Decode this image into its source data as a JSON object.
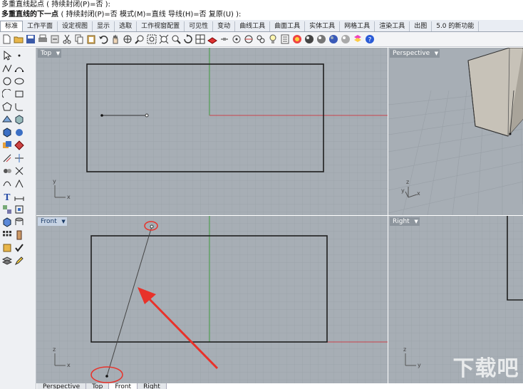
{
  "command": {
    "line1": "多重直线起点 ( 持续封闭(P)=否 ):",
    "line2_prompt": "多重直线的下一点",
    "line2_options": "( 持续封闭(P)=否  模式(M)=直线  导线(H)=否  复原(U) ):"
  },
  "tabs": [
    {
      "label": "标准",
      "active": true
    },
    {
      "label": "工作平面"
    },
    {
      "label": "设定视图"
    },
    {
      "label": "显示"
    },
    {
      "label": "选取"
    },
    {
      "label": "工作视窗配置"
    },
    {
      "label": "可见性"
    },
    {
      "label": "变动"
    },
    {
      "label": "曲线工具"
    },
    {
      "label": "曲面工具"
    },
    {
      "label": "实体工具"
    },
    {
      "label": "网格工具"
    },
    {
      "label": "渲染工具"
    },
    {
      "label": "出图"
    },
    {
      "label": "5.0 的新功能"
    }
  ],
  "toolbar_icons": [
    "new-icon",
    "open-icon",
    "save-icon",
    "print-icon",
    "import-icon",
    "cut-icon",
    "copy-icon",
    "paste-icon",
    "undo-icon",
    "pan-icon",
    "rotate-view-icon",
    "zoom-icon",
    "zoom-window-icon",
    "zoom-extents-icon",
    "zoom-selected-icon",
    "rotate-icon",
    "four-viewports-icon",
    "cplane-icon",
    "select-icon",
    "point-icon",
    "circle-icon",
    "analyze-icon",
    "light-icon",
    "properties-icon",
    "shaded-icon",
    "rendered-icon",
    "render-icon",
    "material-icon",
    "sphere-icon",
    "layer-icon",
    "help-icon"
  ],
  "viewports": {
    "top": "Top",
    "perspective": "Perspective",
    "front": "Front",
    "right": "Right"
  },
  "axes": {
    "x": "x",
    "y": "y",
    "z": "z"
  },
  "bottom_tabs": [
    {
      "label": "Perspective"
    },
    {
      "label": "Top"
    },
    {
      "label": "Front",
      "active": true
    },
    {
      "label": "Right"
    }
  ],
  "watermark": "下载吧",
  "colors": {
    "viewport_bg": "#a7aeb5",
    "grid_line": "#9aa1a8",
    "x_axis": "#c8414a",
    "y_axis": "#3f9c3f",
    "annotation_red": "#e8322a"
  }
}
